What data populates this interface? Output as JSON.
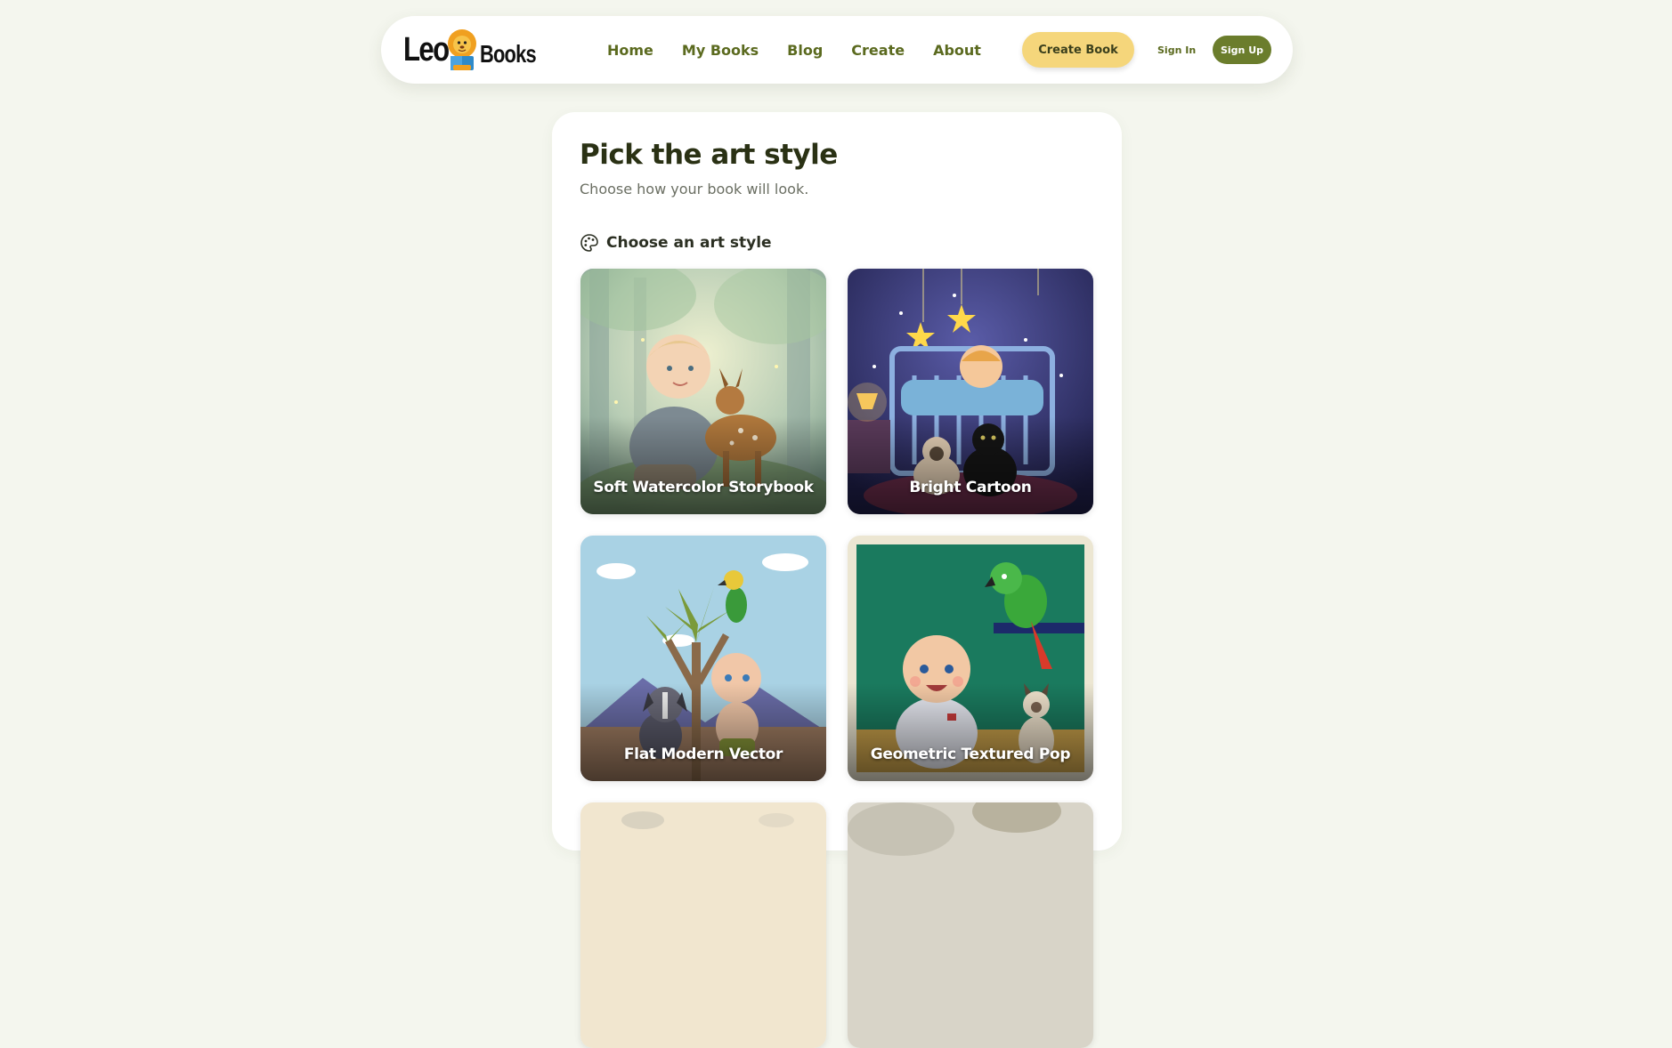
{
  "nav": {
    "logo_left": "Leo",
    "logo_right": "Books",
    "links": [
      "Home",
      "My Books",
      "Blog",
      "Create",
      "About"
    ],
    "create_button": "Create Book",
    "sign_in": "Sign In",
    "sign_up": "Sign Up"
  },
  "page": {
    "title": "Pick the art style",
    "subtitle": "Choose how your book will look.",
    "section_label": "Choose an art style",
    "section_icon": "palette-icon"
  },
  "styles": [
    {
      "label": "Soft Watercolor Storybook"
    },
    {
      "label": "Bright Cartoon"
    },
    {
      "label": "Flat Modern Vector"
    },
    {
      "label": "Geometric Textured Pop"
    },
    {
      "label": ""
    },
    {
      "label": ""
    }
  ],
  "colors": {
    "accent": "#6b7d2c",
    "create_button": "#f5d67b",
    "background": "#f4f6ee"
  }
}
